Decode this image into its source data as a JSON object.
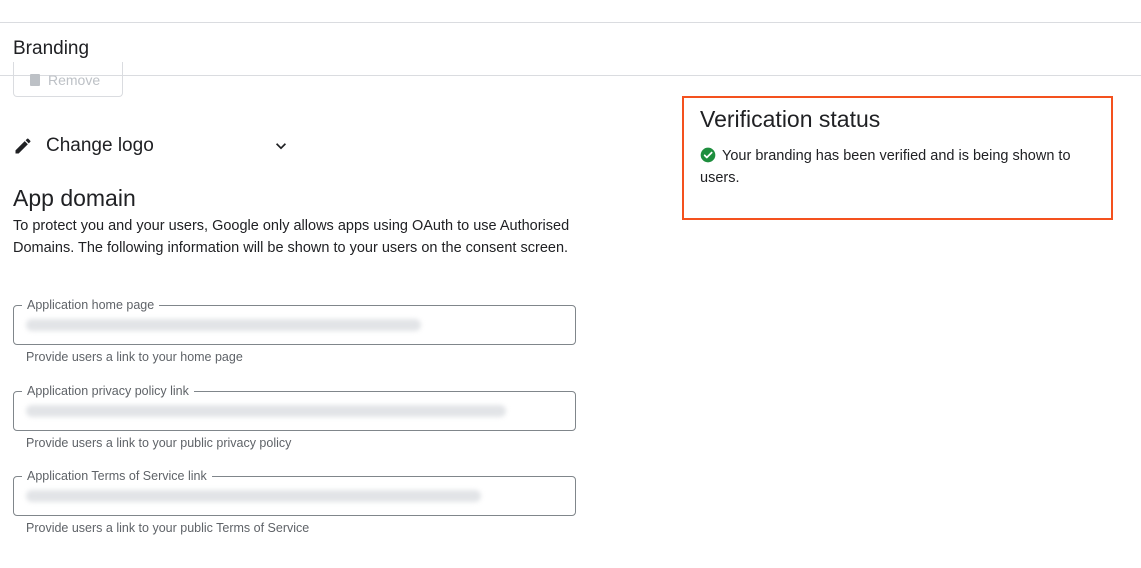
{
  "header": {
    "title": "Branding"
  },
  "logo": {
    "remove_label": "Remove",
    "change_logo_label": "Change logo"
  },
  "app_domain": {
    "title": "App domain",
    "description": "To protect you and your users, Google only allows apps using OAuth to use Authorised Domains. The following information will be shown to your users on the consent screen.",
    "fields": [
      {
        "label": "Application home page",
        "helper": "Provide users a link to your home page"
      },
      {
        "label": "Application privacy policy link",
        "helper": "Provide users a link to your public privacy policy"
      },
      {
        "label": "Application Terms of Service link",
        "helper": "Provide users a link to your public Terms of Service"
      }
    ]
  },
  "verification": {
    "title": "Verification status",
    "message": "Your branding has been verified and is being shown to users.",
    "status_color": "#1e8e3e",
    "highlight_color": "#f4511e"
  },
  "icons": {
    "remove": "trash-icon",
    "change_logo": "pencil-icon",
    "expand": "chevron-down-icon",
    "status": "check-circle-icon"
  }
}
